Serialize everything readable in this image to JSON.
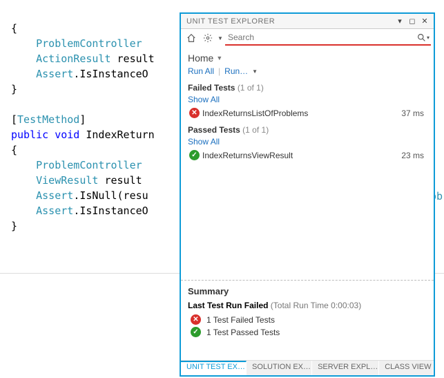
{
  "code": {
    "l1": "{",
    "l2a": "ProblemController",
    "l2b": " ",
    "l3a": "ActionResult",
    "l3b": " result",
    "l4a": "Assert",
    "l4b": ".IsInstanceO",
    "l5": "}",
    "l6": "",
    "l7a": "[",
    "l7b": "TestMethod",
    "l7c": "]",
    "l8a": "public",
    "l8b": " ",
    "l8c": "void",
    "l8d": " IndexReturn",
    "l9": "{",
    "l10a": "ProblemController",
    "l10b": " ",
    "l11a": "ViewResult",
    "l11b": " result ",
    "l12a": "Assert",
    "l12b": ".IsNull(resu",
    "l13a": "Assert",
    "l13b": ".IsInstanceO",
    "l14": "}",
    "rob": "rob"
  },
  "panel": {
    "title": "UNIT TEST EXPLORER",
    "search_placeholder": "Search",
    "home_label": "Home",
    "run_all": "Run All",
    "run": "Run…",
    "failed_group": "Failed Tests",
    "failed_count": "(1 of 1)",
    "show_all": "Show All",
    "failed_test": {
      "name": "IndexReturnsListOfProblems",
      "time": "37 ms"
    },
    "passed_group": "Passed Tests",
    "passed_count": "(1 of 1)",
    "passed_test": {
      "name": "IndexReturnsViewResult",
      "time": "23 ms"
    },
    "summary": {
      "heading": "Summary",
      "status_bold": "Last Test Run Failed",
      "status_time": " (Total Run Time 0:00:03)",
      "failed_line": "1 Test Failed Tests",
      "passed_line": "1 Test Passed Tests"
    },
    "tabs": {
      "unit": "UNIT TEST EX…",
      "solution": "SOLUTION EX…",
      "server": "SERVER EXPL…",
      "classview": "CLASS VIEW"
    }
  }
}
